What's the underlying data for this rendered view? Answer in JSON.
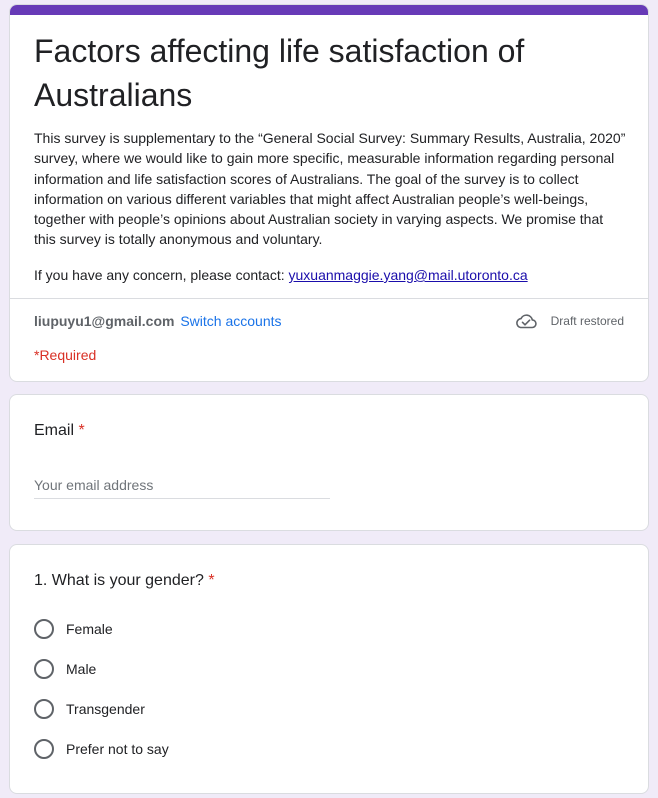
{
  "colors": {
    "brand": "#673ab7",
    "background": "#f0ebf8",
    "required": "#d93025",
    "link": "#1a73e8",
    "mail_link": "#1a0dab"
  },
  "header": {
    "title": "Factors affecting life satisfaction of Australians",
    "description": "This survey is supplementary to the “General Social Survey: Summary Results, Australia, 2020” survey, where we would like to gain more specific, measurable information regarding personal information and life satisfaction scores of Australians. The goal of the survey is to collect information on various different variables that might affect Australian people’s well-beings, together with people’s opinions about Australian society in varying aspects. We promise that this survey is totally anonymous and voluntary.",
    "contact_prefix": "If you have any concern, please contact: ",
    "contact_email": "yuxuanmaggie.yang@mail.utoronto.ca",
    "account_email": "liupuyu1@gmail.com",
    "switch_accounts": "Switch accounts",
    "draft_status": "Draft restored",
    "draft_icon": "cloud-done-icon",
    "required_note": "*Required"
  },
  "questions": [
    {
      "title": "Email",
      "required_mark": "*",
      "type": "text",
      "placeholder": "Your email address",
      "value": ""
    },
    {
      "title": "1. What is your gender?",
      "required_mark": "*",
      "type": "radio",
      "options": [
        "Female",
        "Male",
        "Transgender",
        "Prefer not to say"
      ]
    }
  ]
}
